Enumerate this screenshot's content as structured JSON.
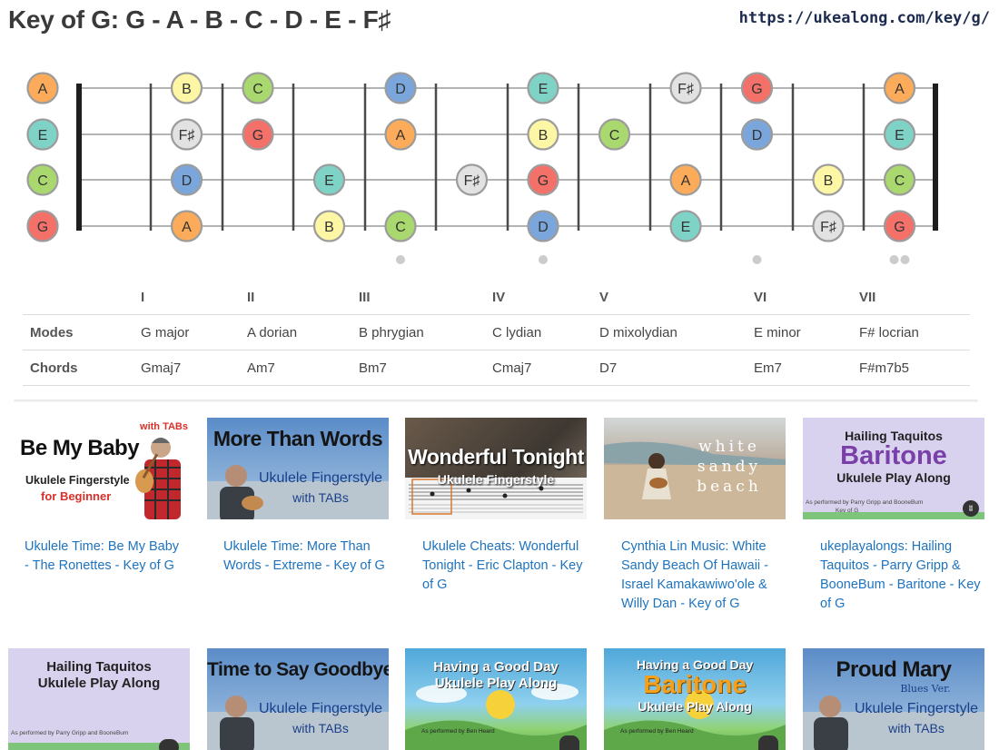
{
  "header": {
    "title": "Key of G: G - A - B - C - D - E - F♯",
    "url": "https://ukealong.com/key/g/"
  },
  "fretboard": {
    "strings": [
      "A",
      "E",
      "C",
      "G"
    ],
    "note_colors": {
      "G": "#f4716a",
      "A": "#fbab59",
      "B": "#fdf7a5",
      "C": "#a9d86e",
      "D": "#7aa6dc",
      "E": "#7fd3c6",
      "F♯": "#e2e2e2"
    },
    "notes": [
      {
        "string": 0,
        "fret": 0,
        "note": "A"
      },
      {
        "string": 0,
        "fret": 2,
        "note": "B"
      },
      {
        "string": 0,
        "fret": 3,
        "note": "C"
      },
      {
        "string": 0,
        "fret": 5,
        "note": "D"
      },
      {
        "string": 0,
        "fret": 7,
        "note": "E"
      },
      {
        "string": 0,
        "fret": 9,
        "note": "F♯"
      },
      {
        "string": 0,
        "fret": 10,
        "note": "G"
      },
      {
        "string": 0,
        "fret": 12,
        "note": "A"
      },
      {
        "string": 1,
        "fret": 0,
        "note": "E"
      },
      {
        "string": 1,
        "fret": 2,
        "note": "F♯"
      },
      {
        "string": 1,
        "fret": 3,
        "note": "G"
      },
      {
        "string": 1,
        "fret": 5,
        "note": "A"
      },
      {
        "string": 1,
        "fret": 7,
        "note": "B"
      },
      {
        "string": 1,
        "fret": 8,
        "note": "C"
      },
      {
        "string": 1,
        "fret": 10,
        "note": "D"
      },
      {
        "string": 1,
        "fret": 12,
        "note": "E"
      },
      {
        "string": 2,
        "fret": 0,
        "note": "C"
      },
      {
        "string": 2,
        "fret": 2,
        "note": "D"
      },
      {
        "string": 2,
        "fret": 4,
        "note": "E"
      },
      {
        "string": 2,
        "fret": 6,
        "note": "F♯"
      },
      {
        "string": 2,
        "fret": 7,
        "note": "G"
      },
      {
        "string": 2,
        "fret": 9,
        "note": "A"
      },
      {
        "string": 2,
        "fret": 11,
        "note": "B"
      },
      {
        "string": 2,
        "fret": 12,
        "note": "C"
      },
      {
        "string": 3,
        "fret": 0,
        "note": "G"
      },
      {
        "string": 3,
        "fret": 2,
        "note": "A"
      },
      {
        "string": 3,
        "fret": 4,
        "note": "B"
      },
      {
        "string": 3,
        "fret": 5,
        "note": "C"
      },
      {
        "string": 3,
        "fret": 7,
        "note": "D"
      },
      {
        "string": 3,
        "fret": 9,
        "note": "E"
      },
      {
        "string": 3,
        "fret": 11,
        "note": "F♯"
      },
      {
        "string": 3,
        "fret": 12,
        "note": "G"
      }
    ],
    "fret_markers": [
      5,
      7,
      10,
      12
    ],
    "double_marker_fret": 12,
    "marker_color": "#cccccc"
  },
  "modes_table": {
    "degrees": [
      "I",
      "II",
      "III",
      "IV",
      "V",
      "VI",
      "VII"
    ],
    "modes_label": "Modes",
    "modes": [
      "G major",
      "A dorian",
      "B phrygian",
      "C lydian",
      "D mixolydian",
      "E minor",
      "F# locrian"
    ],
    "chords_label": "Chords",
    "chords": [
      "Gmaj7",
      "Am7",
      "Bm7",
      "Cmaj7",
      "D7",
      "Em7",
      "F#m7b5"
    ]
  },
  "videos": [
    {
      "title": "Ukulele Time: Be My Baby - The Ronettes - Key of G",
      "thumb": {
        "main": "Be My Baby",
        "sub1": "Ukulele Fingerstyle",
        "sub2": "for Beginner",
        "corner": "with TABs"
      }
    },
    {
      "title": "Ukulele Time: More Than Words - Extreme - Key of G",
      "thumb": {
        "main": "More Than Words",
        "sub1": "Ukulele Fingerstyle",
        "sub2": "with TABs"
      }
    },
    {
      "title": "Ukulele Cheats: Wonderful Tonight - Eric Clapton - Key of G",
      "thumb": {
        "main": "Wonderful Tonight",
        "sub1": "Ukulele Fingerstyle"
      }
    },
    {
      "title": "Cynthia Lin Music: White Sandy Beach Of Hawaii - Israel Kamakawiwo'ole & Willy Dan - Key of G",
      "thumb": {
        "line1": "white",
        "line2": "sandy",
        "line3": "beach"
      }
    },
    {
      "title": "ukeplayalongs: Hailing Taquitos - Parry Gripp & BooneBum - Baritone - Key of G",
      "thumb": {
        "line1": "Hailing Taquitos",
        "main": "Baritone",
        "line2": "Ukulele Play Along",
        "credit": "As performed by Parry Gripp and BooneBum",
        "key": "Key of G"
      }
    },
    {
      "thumb": {
        "line1": "Hailing Taquitos",
        "line2": "Ukulele Play Along",
        "credit": "As performed by Parry Gripp and BooneBum"
      }
    },
    {
      "thumb": {
        "main": "Time to Say Goodbye",
        "sub1": "Ukulele Fingerstyle",
        "sub2": "with TABs"
      }
    },
    {
      "thumb": {
        "line1": "Having a Good Day",
        "line2": "Ukulele Play Along",
        "credit": "As performed by Ben Heard"
      }
    },
    {
      "thumb": {
        "line1": "Having a Good Day",
        "main": "Baritone",
        "line2": "Ukulele Play Along",
        "credit": "As performed by Ben Heard"
      }
    },
    {
      "thumb": {
        "main": "Proud Mary",
        "sub0": "Blues Ver.",
        "sub1": "Ukulele Fingerstyle",
        "sub2": "with TABs"
      }
    }
  ]
}
